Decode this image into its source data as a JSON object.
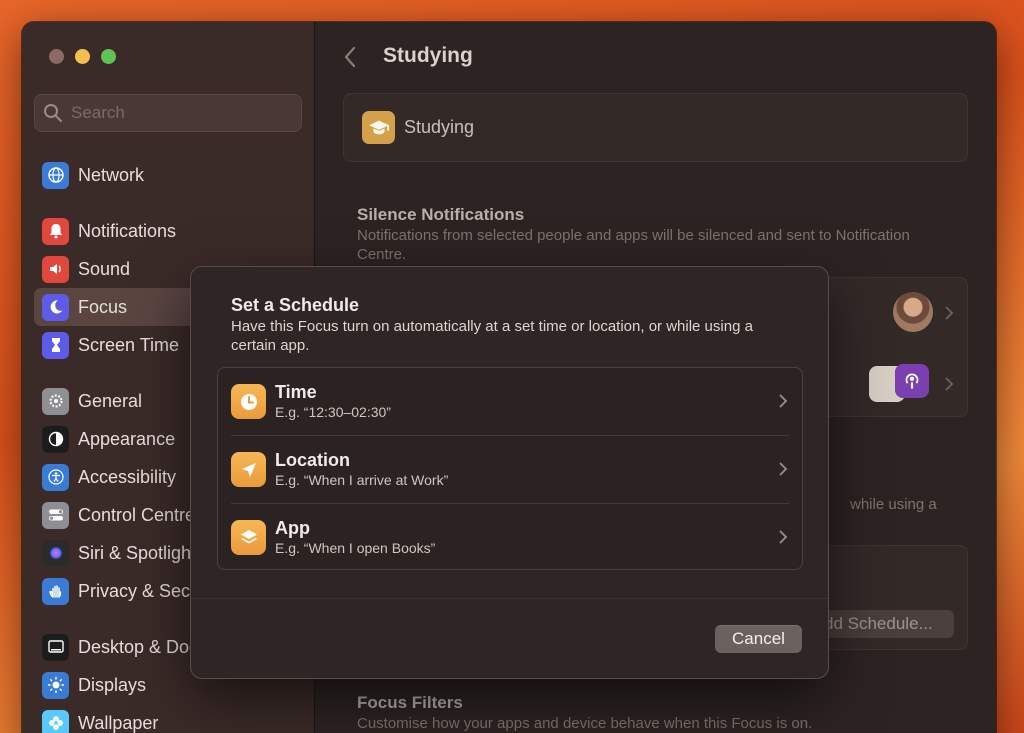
{
  "window": {
    "traffic_lights": [
      "close",
      "minimize",
      "maximize"
    ]
  },
  "sidebar": {
    "search_placeholder": "Search",
    "items": [
      {
        "label": "Network",
        "icon": "globe-icon",
        "color": "#3a7bd5"
      },
      {
        "label": "Notifications",
        "icon": "bell-icon",
        "color": "#e0483e"
      },
      {
        "label": "Sound",
        "icon": "speaker-icon",
        "color": "#e0483e"
      },
      {
        "label": "Focus",
        "icon": "moon-icon",
        "color": "#5e5ce6",
        "active": true
      },
      {
        "label": "Screen Time",
        "icon": "hourglass-icon",
        "color": "#5e5ce6"
      },
      {
        "label": "General",
        "icon": "gear-icon",
        "color": "#8e8e93"
      },
      {
        "label": "Appearance",
        "icon": "appearance-icon",
        "color": "#1c1c1e"
      },
      {
        "label": "Accessibility",
        "icon": "accessibility-icon",
        "color": "#3a7bd5"
      },
      {
        "label": "Control Centre",
        "icon": "toggles-icon",
        "color": "#8e8e93"
      },
      {
        "label": "Siri & Spotlight",
        "icon": "siri-icon",
        "color": "#2b2b2b"
      },
      {
        "label": "Privacy & Security",
        "icon": "hand-icon",
        "color": "#3a7bd5"
      },
      {
        "label": "Desktop & Dock",
        "icon": "dock-icon",
        "color": "#1c1c1e"
      },
      {
        "label": "Displays",
        "icon": "sun-icon",
        "color": "#3a7bd5"
      },
      {
        "label": "Wallpaper",
        "icon": "flower-icon",
        "color": "#5ac8fa"
      }
    ]
  },
  "main": {
    "title": "Studying",
    "focus_name": "Studying",
    "silence": {
      "heading": "Silence Notifications",
      "description": "Notifications from selected people and apps will be silenced and sent to Notification Centre."
    },
    "partial_text": "while using a",
    "add_schedule": "dd Schedule...",
    "filters": {
      "heading": "Focus Filters",
      "description": "Customise how your apps and device behave when this Focus is on."
    }
  },
  "modal": {
    "title": "Set a Schedule",
    "description": "Have this Focus turn on automatically at a set time or location, or while using a certain app.",
    "options": [
      {
        "label": "Time",
        "example": "E.g. “12:30–02:30”",
        "icon": "clock-icon"
      },
      {
        "label": "Location",
        "example": "E.g. “When I arrive at Work”",
        "icon": "location-arrow-icon"
      },
      {
        "label": "App",
        "example": "E.g. “When I open Books”",
        "icon": "layers-icon"
      }
    ],
    "cancel_label": "Cancel"
  }
}
